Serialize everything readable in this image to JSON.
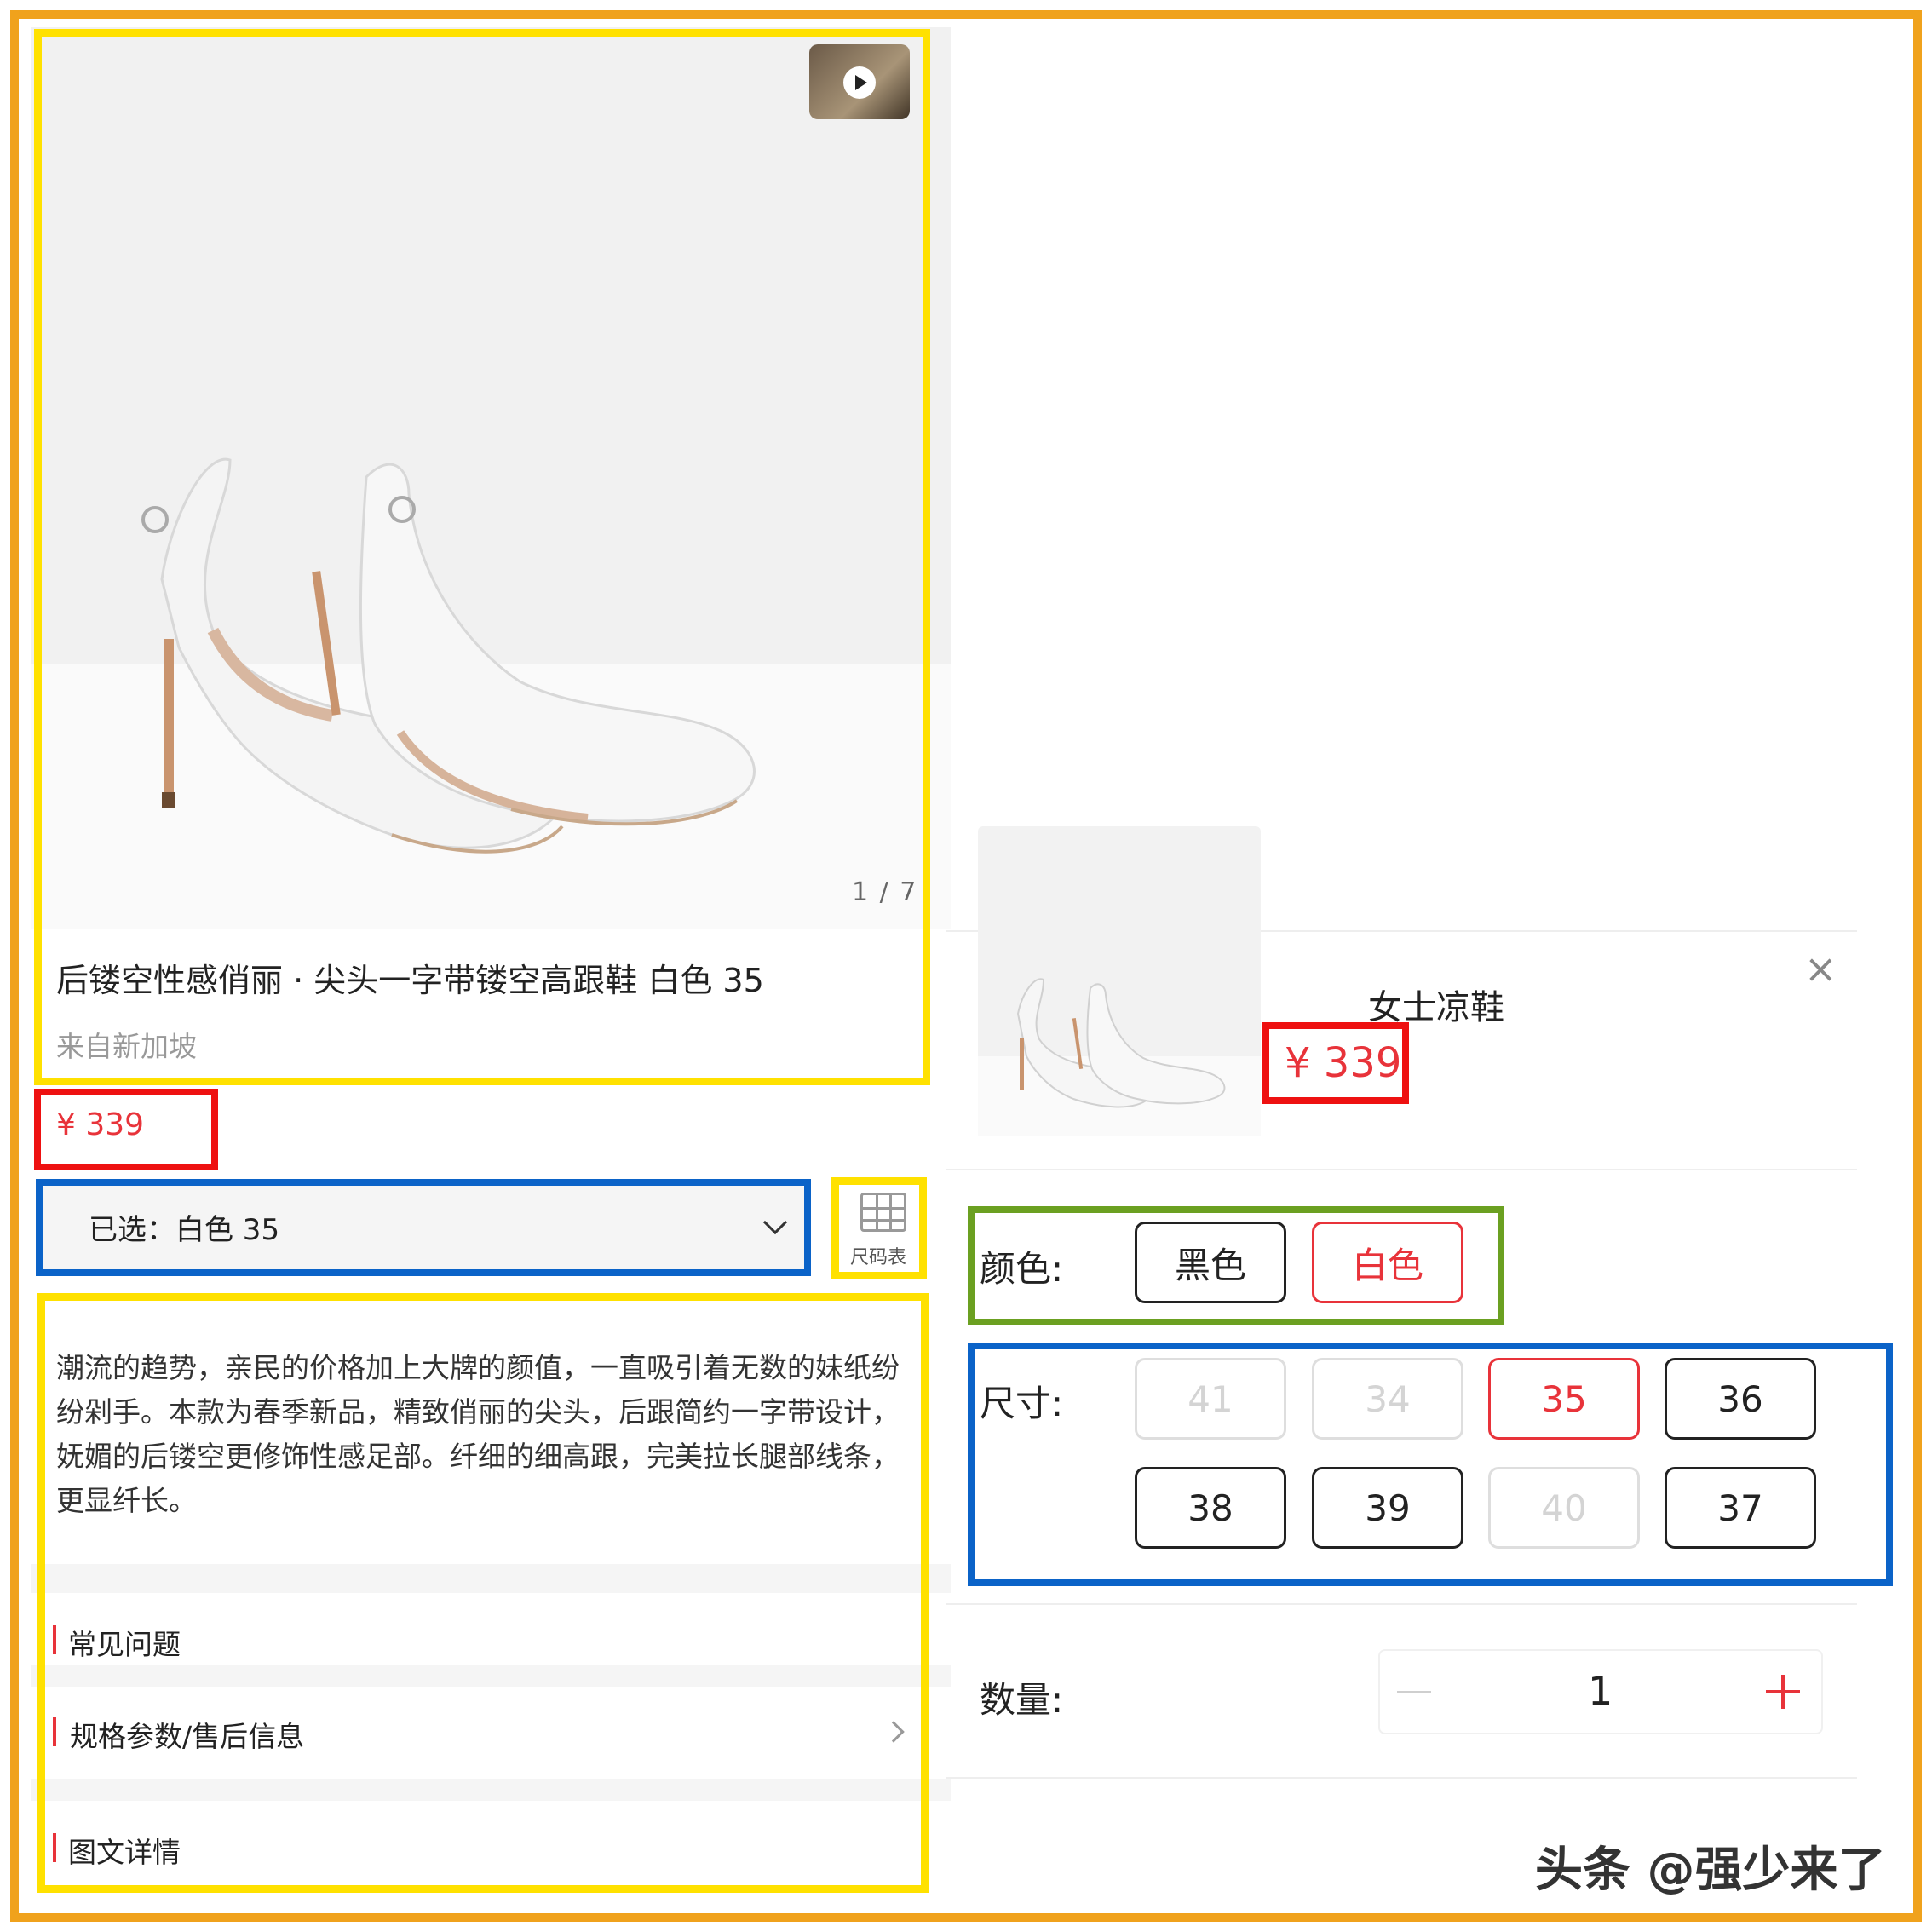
{
  "product": {
    "pager": "1 / 7",
    "title": "后镂空性感俏丽 · 尖头一字带镂空高跟鞋 白色 35",
    "origin": "来自新加坡",
    "price": "¥ 339",
    "selected": "已选：白色 35",
    "size_chart_label": "尺码表",
    "description": "潮流的趋势，亲民的价格加上大牌的颜值，一直吸引着无数的妹纸纷纷剁手。本款为春季新品，精致俏丽的尖头，后跟简约一字带设计，妩媚的后镂空更修饰性感足部。纤细的细高跟，完美拉长腿部线条，更显纤长。"
  },
  "sections": {
    "faq": "常见问题",
    "specs": "规格参数/售后信息",
    "details": "图文详情"
  },
  "sheet": {
    "name": "女士凉鞋",
    "price": "¥ 339",
    "close_icon": "×",
    "color_label": "颜色:",
    "colors": [
      "黑色",
      "白色"
    ],
    "selected_color": "白色",
    "size_label": "尺寸:",
    "sizes": [
      "41",
      "34",
      "35",
      "36",
      "38",
      "39",
      "40",
      "37"
    ],
    "selected_size": "35",
    "disabled_sizes": [
      "41",
      "34",
      "40"
    ],
    "qty_label": "数量:",
    "qty": "1"
  },
  "watermark": "头条 @强少来了",
  "colors": {
    "accent": "#e8333a",
    "annotation_yellow": "#ffe100",
    "annotation_red": "#ee1111",
    "annotation_blue": "#0b63c8",
    "annotation_green": "#6ba021",
    "outer_frame": "#f0a21c"
  }
}
